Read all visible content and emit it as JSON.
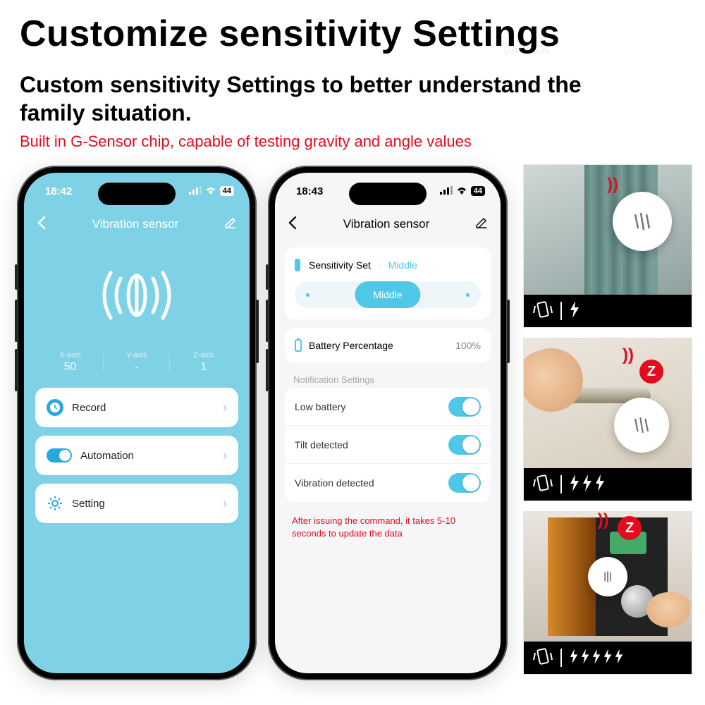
{
  "headline": "Customize sensitivity Settings",
  "subhead": "Custom sensitivity Settings to better understand the family situation.",
  "note": "Built in G-Sensor chip, capable of testing gravity and angle values",
  "watermark": "forubest",
  "phone1": {
    "time": "18:42",
    "signal_badge": "44",
    "title": "Vibration sensor",
    "axes": [
      {
        "label": "X-axis",
        "value": "50"
      },
      {
        "label": "Y-axis",
        "value": "-"
      },
      {
        "label": "Z-axis",
        "value": "1"
      }
    ],
    "cards": {
      "record": "Record",
      "automation": "Automation",
      "setting": "Setting"
    }
  },
  "phone2": {
    "time": "18:43",
    "signal_badge": "44",
    "title": "Vibration sensor",
    "sensitivity": {
      "label": "Sensitivity Set",
      "value": "Middle",
      "pill": "Middle"
    },
    "battery": {
      "label": "Battery Percentage",
      "value": "100%"
    },
    "section": "Notification Settings",
    "toggles": {
      "low_battery": "Low battery",
      "tilt": "Tilt detected",
      "vibration": "Vibration detected"
    },
    "cmd_note": "After issuing the command, it takes 5-10 seconds to update the data"
  },
  "thumbs": {
    "z_label": "Z",
    "bolt_counts": [
      1,
      3,
      5
    ]
  }
}
